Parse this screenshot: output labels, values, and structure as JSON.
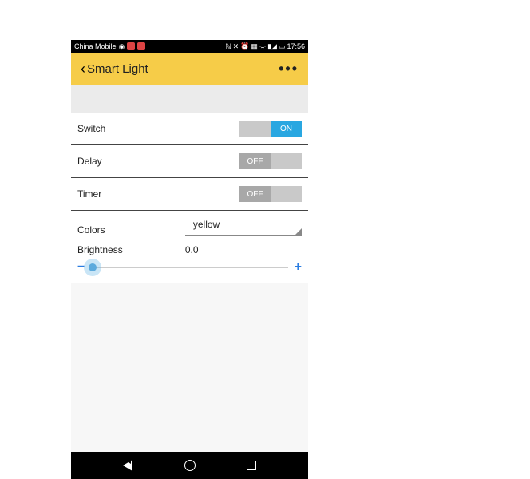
{
  "status": {
    "carrier": "China Mobile",
    "time": "17:56"
  },
  "header": {
    "title": "Smart Light",
    "more": "•••"
  },
  "rows": {
    "switch": {
      "label": "Switch",
      "state_label": "ON"
    },
    "delay": {
      "label": "Delay",
      "state_label": "OFF"
    },
    "timer": {
      "label": "Timer",
      "state_label": "OFF"
    },
    "colors": {
      "label": "Colors",
      "value": "yellow"
    },
    "brightness": {
      "label": "Brightness",
      "value": "0.0"
    }
  },
  "slider": {
    "minus": "−",
    "plus": "+"
  }
}
